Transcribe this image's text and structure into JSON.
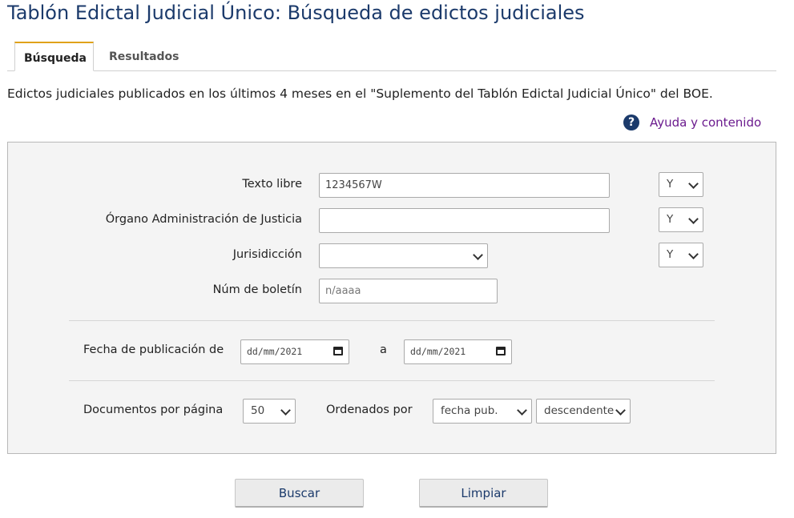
{
  "page": {
    "title": "Tablón Edictal Judicial Único: Búsqueda de edictos judiciales",
    "description": "Edictos judiciales publicados en los últimos 4 meses en el \"Suplemento del Tablón Edictal Judicial Único\" del BOE."
  },
  "tabs": [
    {
      "label": "Búsqueda",
      "active": true
    },
    {
      "label": "Resultados",
      "active": false
    }
  ],
  "help": {
    "icon": "question-circle-icon",
    "label": "Ayuda y contenido"
  },
  "form": {
    "texto_libre": {
      "label": "Texto libre",
      "value": "1234567W",
      "operator": "Y"
    },
    "organo": {
      "label": "Órgano Administración de Justicia",
      "value": "",
      "operator": "Y"
    },
    "jurisdiccion": {
      "label": "Jurisidicción",
      "value": "",
      "operator": "Y"
    },
    "num_boletin": {
      "label": "Núm de boletín",
      "placeholder": "n/aaaa"
    },
    "fecha": {
      "label": "Fecha de publicación de",
      "from": "dd/mm/2021",
      "separator": "a",
      "to": "dd/mm/2021"
    },
    "documentos": {
      "label": "Documentos por página",
      "value": "50"
    },
    "orden": {
      "label": "Ordenados por",
      "field": "fecha pub.",
      "direction": "descendente"
    }
  },
  "buttons": {
    "search": "Buscar",
    "clear": "Limpiar"
  },
  "colors": {
    "title": "#1b3a6b",
    "tab_accent": "#e0a21a",
    "help_link": "#6b1b8e"
  }
}
